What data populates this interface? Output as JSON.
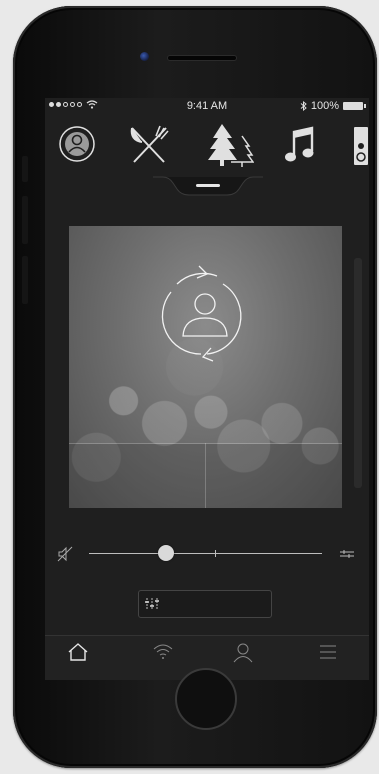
{
  "status_bar": {
    "carrier_signal": "●●○○○",
    "time": "9:41 AM",
    "battery_percent": "100%"
  },
  "top_icons": [
    "profile-sync-icon",
    "restaurant-icon",
    "forest-icon",
    "music-icon",
    "speaker-icon"
  ],
  "main_image": {
    "overlay_icon": "profile-sync-icon"
  },
  "volume": {
    "level": 0.33,
    "mute_icon": "speaker-muted-icon",
    "settings_icon": "sliders-icon"
  },
  "equalizer_button": {
    "icon": "equalizer-icon"
  },
  "tab_bar": {
    "tabs": [
      "home-icon",
      "wifi-icon",
      "user-icon",
      "menu-icon"
    ]
  },
  "colors": {
    "screen_bg": "#1f1f1f",
    "icon": "#e0e0e0",
    "accent_line": "#bdbdbd"
  }
}
